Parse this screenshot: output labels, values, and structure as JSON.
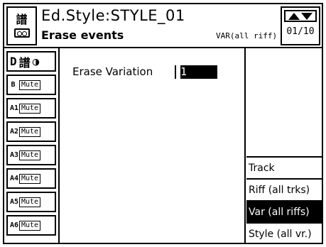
{
  "header": {
    "title": "Ed.Style:STYLE_01",
    "subtitle": "Erase events",
    "variation_label": "VAR(all riff)",
    "page": "01/10"
  },
  "tracks": [
    {
      "tag": "D",
      "mute": ""
    },
    {
      "tag": "B",
      "mute": "Mute"
    },
    {
      "tag": "A1",
      "mute": "Mute"
    },
    {
      "tag": "A2",
      "mute": "Mute"
    },
    {
      "tag": "A3",
      "mute": "Mute"
    },
    {
      "tag": "A4",
      "mute": "Mute"
    },
    {
      "tag": "A5",
      "mute": "Mute"
    },
    {
      "tag": "A6",
      "mute": "Mute"
    }
  ],
  "main": {
    "param_label": "Erase Variation",
    "param_value": "1"
  },
  "menu": {
    "items": [
      "Track",
      "Riff (all trks)",
      "Var (all riffs)",
      "Style (all vr.)"
    ],
    "selected_index": 2
  }
}
